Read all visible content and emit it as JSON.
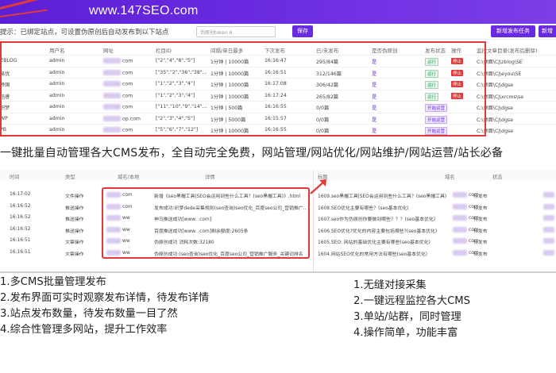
{
  "banner": {
    "site": "www.147SEO.com"
  },
  "toolbar": {
    "hint": "提示：已绑定站点，可设置伪原创后自动发布到以下站点",
    "token_placeholder": "伪原创token  6",
    "save_label": "保存",
    "new_task_label": "新增发布任务",
    "more_label": "新增"
  },
  "sites_table": {
    "headers": [
      "",
      "用户名",
      "网址",
      "栏目ID",
      "间隔/单日最多",
      "下次发布",
      "已/未发布",
      "是否伪原创",
      "发布状态",
      "操作",
      "监控文章目录(发布后删除)"
    ],
    "rows": [
      {
        "cms": "ZBLOG",
        "user": "admin",
        "url": "com",
        "cat": "[\"2\",\"4\",\"8\",\"5\"]",
        "interval": "1分钟 | 10000篇",
        "next": "16:16:47",
        "count": "295/84篇",
        "pseudo": "是",
        "status": "运行",
        "action": "停止",
        "dir": "C:\\桌面\\CJ\\zblog\\SE"
      },
      {
        "cms": "易优",
        "user": "admin",
        "url": "com",
        "cat": "[\"35\",\"2\",\"36\",\"38\"...",
        "interval": "1分钟 | 10000篇",
        "next": "16:16:51",
        "count": "312/146篇",
        "pseudo": "是",
        "status": "运行",
        "action": "停止",
        "dir": "C:\\桌面\\CJ\\eyou\\SE"
      },
      {
        "cms": "帝国",
        "user": "admin",
        "url": "com",
        "cat": "[\"1\",\"2\",\"3\",\"4\"]",
        "interval": "1分钟 | 10000篇",
        "next": "16:17:08",
        "count": "306/42篇",
        "pseudo": "是",
        "status": "运行",
        "action": "停止",
        "dir": "C:\\桌面\\CJ\\dgse"
      },
      {
        "cms": "迅睿",
        "user": "admin",
        "url": "com",
        "cat": "[\"1\",\"2\",\"3\",\"4\"]",
        "interval": "1分钟 | 10000篇",
        "next": "16:17:24",
        "count": "265/82篇",
        "pseudo": "是",
        "status": "运行",
        "action": "停止",
        "dir": "C:\\桌面\\CJ\\xrcms\\se"
      },
      {
        "cms": "织梦",
        "user": "admin",
        "url": "com",
        "cat": "[\"11\",\"10\",\"9\",\"14\"...",
        "interval": "1分钟 | 500篇",
        "next": "16:16:55",
        "count": "0/0篇",
        "pseudo": "是",
        "status": "开始运营",
        "action": "",
        "dir": "C:\\桌面\\CJ\\dgse"
      },
      {
        "cms": "WP",
        "user": "admin",
        "url": "op.com",
        "cat": "[\"2\",\"3\",\"4\",\"5\"]",
        "interval": "1分钟 | 5000篇",
        "next": "16:15:57",
        "count": "0/0篇",
        "pseudo": "是",
        "status": "开始运营",
        "action": "",
        "dir": "C:\\桌面\\CJ\\dgse"
      },
      {
        "cms": "PB",
        "user": "admin",
        "url": "com",
        "cat": "[\"5\",\"6\",\"7\",\"12\"]",
        "interval": "1分钟 | 10000篇",
        "next": "16:16:55",
        "count": "0/0篇",
        "pseudo": "是",
        "status": "开始运营",
        "action": "",
        "dir": "C:\\桌面\\CJ\\dgse"
      }
    ]
  },
  "headline": "一键批量自动管理各大CMS发布，全自动完全免费，网站管理/网站优化/网站维护/网站运营/站长必备",
  "log_table": {
    "headers": [
      "时间",
      "类型",
      "域名/本地",
      "详情",
      "标题",
      "域名",
      "状态"
    ],
    "rows": [
      {
        "time": "16:17:02",
        "type": "文件操作",
        "domain": "com",
        "detail": "新增《seo黑帽工具|SEO会运用到些什么工具？(seo黑帽工具)》.html",
        "title": "1609.seo黑帽工具|SEO会运用到些什么工具？(seo黑帽工具)",
        "site": "com",
        "state": "待发布"
      },
      {
        "time": "16:16:52",
        "type": "推送操作",
        "domain": "com",
        "detail": "发布成功:织梦dede采集规则(seo查询)seo优化_百度seo公司_营销推广...",
        "title": "1608.SEO优化主要有哪些？(seo基本优化)",
        "site": "com",
        "state": "待发布"
      },
      {
        "time": "16:16:52",
        "type": "推送操作",
        "domain": "ww",
        "detail": "神马推送成功[www.        .com]",
        "title": "1607.seo作为伪原创你要做到哪些？？？(seo基本优化)",
        "site": "com",
        "state": "待发布"
      },
      {
        "time": "16:16:52",
        "type": "推送操作",
        "domain": "ww",
        "detail": "百度推送成功[www.        .com]剩余额度:2605条",
        "title": "1606.SEO优化?优化的内容主要包括哪些?(seo基本优化)",
        "site": "com",
        "state": "待发布"
      },
      {
        "time": "16:16:51",
        "type": "文章操作",
        "domain": "ww",
        "detail": "伪原创成功 消耗次数:32180",
        "title": "1605.SEO: 网站的基础优化主要有哪些(seo基本优化)",
        "site": "com",
        "state": "待发布"
      },
      {
        "time": "16:16:51",
        "type": "文章操作",
        "domain": "ww",
        "detail": "伪原创成功:(seo查询)seo优化_百度seo公司_营销推广服务_关键词排名",
        "title": "1604.网站SEO优化的常用方法有哪些(seo基本优化)",
        "site": "com",
        "state": "待发布"
      }
    ]
  },
  "features_left": [
    "1.多CMS批量管理发布",
    "2.发布界面可实时观察发布详情，待发布详情",
    "3.站点发布数量，待发布数量一目了然",
    "4.综合性管理多网站，提升工作效率"
  ],
  "features_right": [
    "1.无缝对接采集",
    "2.一键远程监控各大CMS",
    "3.单站/站群，同时管理",
    "4.操作简单，功能丰富"
  ],
  "colors": {
    "brand": "#6a2be0",
    "highlight": "#e23a3a"
  }
}
